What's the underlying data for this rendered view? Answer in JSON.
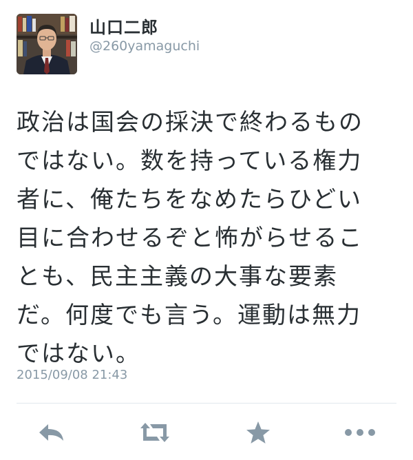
{
  "user": {
    "display_name": "山口二郎",
    "handle": "@260yamaguchi",
    "avatar_icon": "profile-photo"
  },
  "tweet": {
    "lines": [
      "政治は国会の採決で終わるもの",
      "ではない。数を持っている権力",
      "者に、俺たちをなめたらひどい",
      "目に合わせるぞと怖がらせるこ",
      "とも、民主主義の大事な要素",
      "だ。何度でも言う。運動は無力",
      "ではない。"
    ],
    "timestamp": "2015/09/08 21:43"
  },
  "actions": [
    {
      "icon": "reply-icon"
    },
    {
      "icon": "retweet-icon"
    },
    {
      "icon": "favorite-star-icon"
    },
    {
      "icon": "more-icon"
    }
  ],
  "colors": {
    "text": "#292f33",
    "muted": "#8899a6",
    "icon": "#8899a6",
    "divider": "#e1e8ed"
  }
}
